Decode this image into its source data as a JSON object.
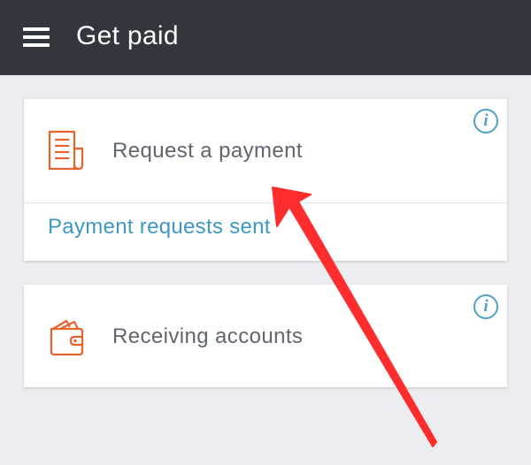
{
  "header": {
    "title": "Get paid",
    "menu_icon": "hamburger-menu-icon"
  },
  "cards": [
    {
      "label": "Request a payment",
      "icon": "document-icon",
      "info_icon": "info-icon",
      "link_label": "Payment requests sent"
    },
    {
      "label": "Receiving accounts",
      "icon": "wallet-icon",
      "info_icon": "info-icon"
    }
  ],
  "colors": {
    "header_bg": "#32363d",
    "accent_orange": "#e8622e",
    "link_blue": "#3f98c3",
    "annotation_red": "#ff2d2d"
  }
}
